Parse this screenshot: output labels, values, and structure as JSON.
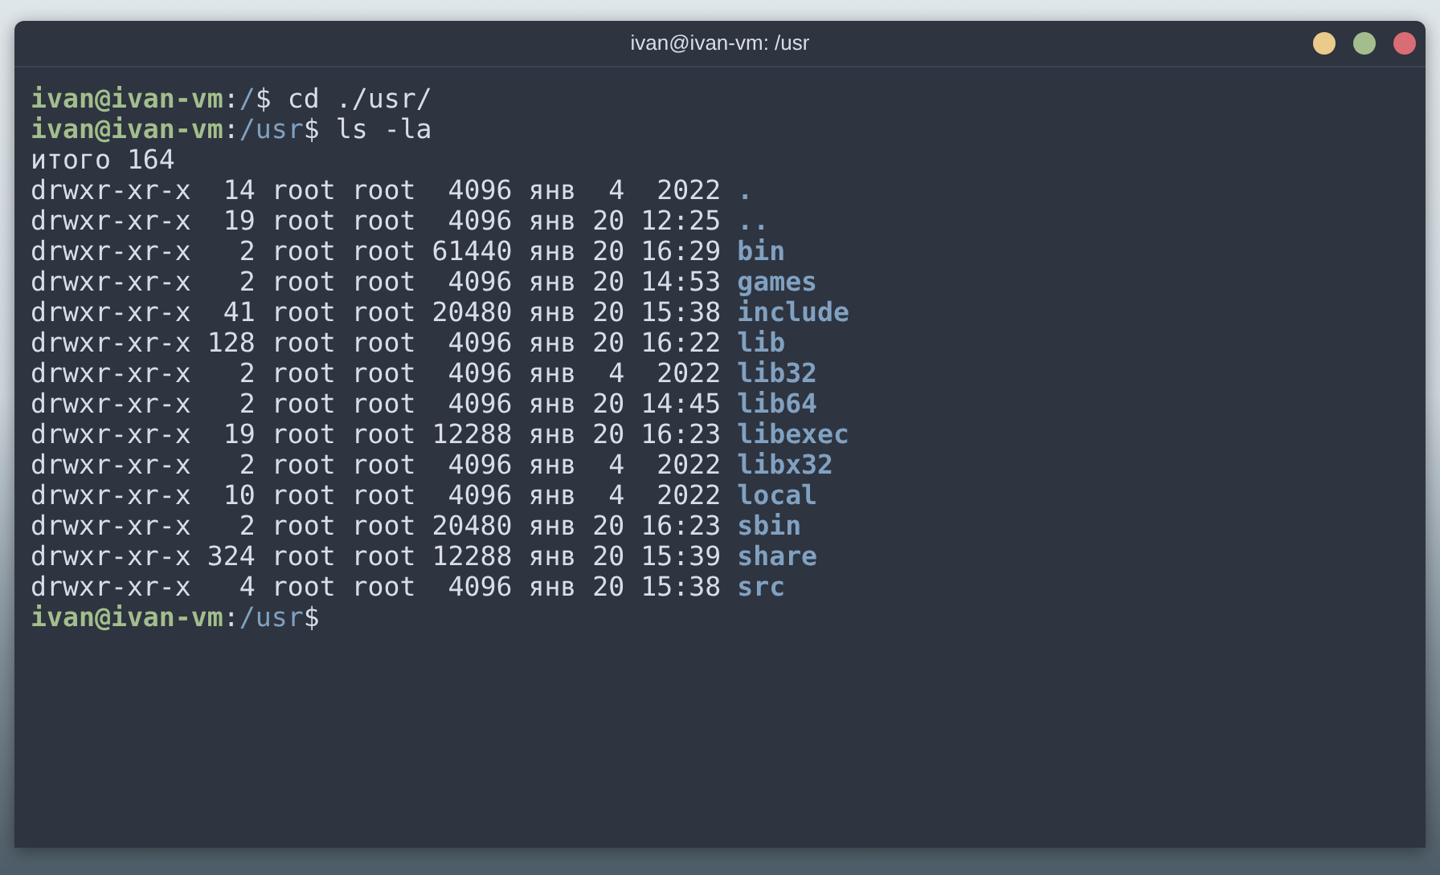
{
  "window": {
    "title": "ivan@ivan-vm: /usr"
  },
  "terminal": {
    "lines": [
      {
        "kind": "prompt",
        "user": "ivan@ivan-vm",
        "separator": ":",
        "path": "/",
        "symbol": "$",
        "command": "cd ./usr/"
      },
      {
        "kind": "prompt",
        "user": "ivan@ivan-vm",
        "separator": ":",
        "path": "/usr",
        "symbol": "$",
        "command": "ls -la"
      },
      {
        "kind": "text",
        "text": "итого 164"
      },
      {
        "kind": "entry",
        "meta": "drwxr-xr-x  14 root root  4096 янв  4  2022",
        "name": "."
      },
      {
        "kind": "entry",
        "meta": "drwxr-xr-x  19 root root  4096 янв 20 12:25",
        "name": ".."
      },
      {
        "kind": "entry",
        "meta": "drwxr-xr-x   2 root root 61440 янв 20 16:29",
        "name": "bin"
      },
      {
        "kind": "entry",
        "meta": "drwxr-xr-x   2 root root  4096 янв 20 14:53",
        "name": "games"
      },
      {
        "kind": "entry",
        "meta": "drwxr-xr-x  41 root root 20480 янв 20 15:38",
        "name": "include"
      },
      {
        "kind": "entry",
        "meta": "drwxr-xr-x 128 root root  4096 янв 20 16:22",
        "name": "lib"
      },
      {
        "kind": "entry",
        "meta": "drwxr-xr-x   2 root root  4096 янв  4  2022",
        "name": "lib32"
      },
      {
        "kind": "entry",
        "meta": "drwxr-xr-x   2 root root  4096 янв 20 14:45",
        "name": "lib64"
      },
      {
        "kind": "entry",
        "meta": "drwxr-xr-x  19 root root 12288 янв 20 16:23",
        "name": "libexec"
      },
      {
        "kind": "entry",
        "meta": "drwxr-xr-x   2 root root  4096 янв  4  2022",
        "name": "libx32"
      },
      {
        "kind": "entry",
        "meta": "drwxr-xr-x  10 root root  4096 янв  4  2022",
        "name": "local"
      },
      {
        "kind": "entry",
        "meta": "drwxr-xr-x   2 root root 20480 янв 20 16:23",
        "name": "sbin"
      },
      {
        "kind": "entry",
        "meta": "drwxr-xr-x 324 root root 12288 янв 20 15:39",
        "name": "share"
      },
      {
        "kind": "entry",
        "meta": "drwxr-xr-x   4 root root  4096 янв 20 15:38",
        "name": "src"
      },
      {
        "kind": "prompt",
        "user": "ivan@ivan-vm",
        "separator": ":",
        "path": "/usr",
        "symbol": "$"
      }
    ]
  }
}
